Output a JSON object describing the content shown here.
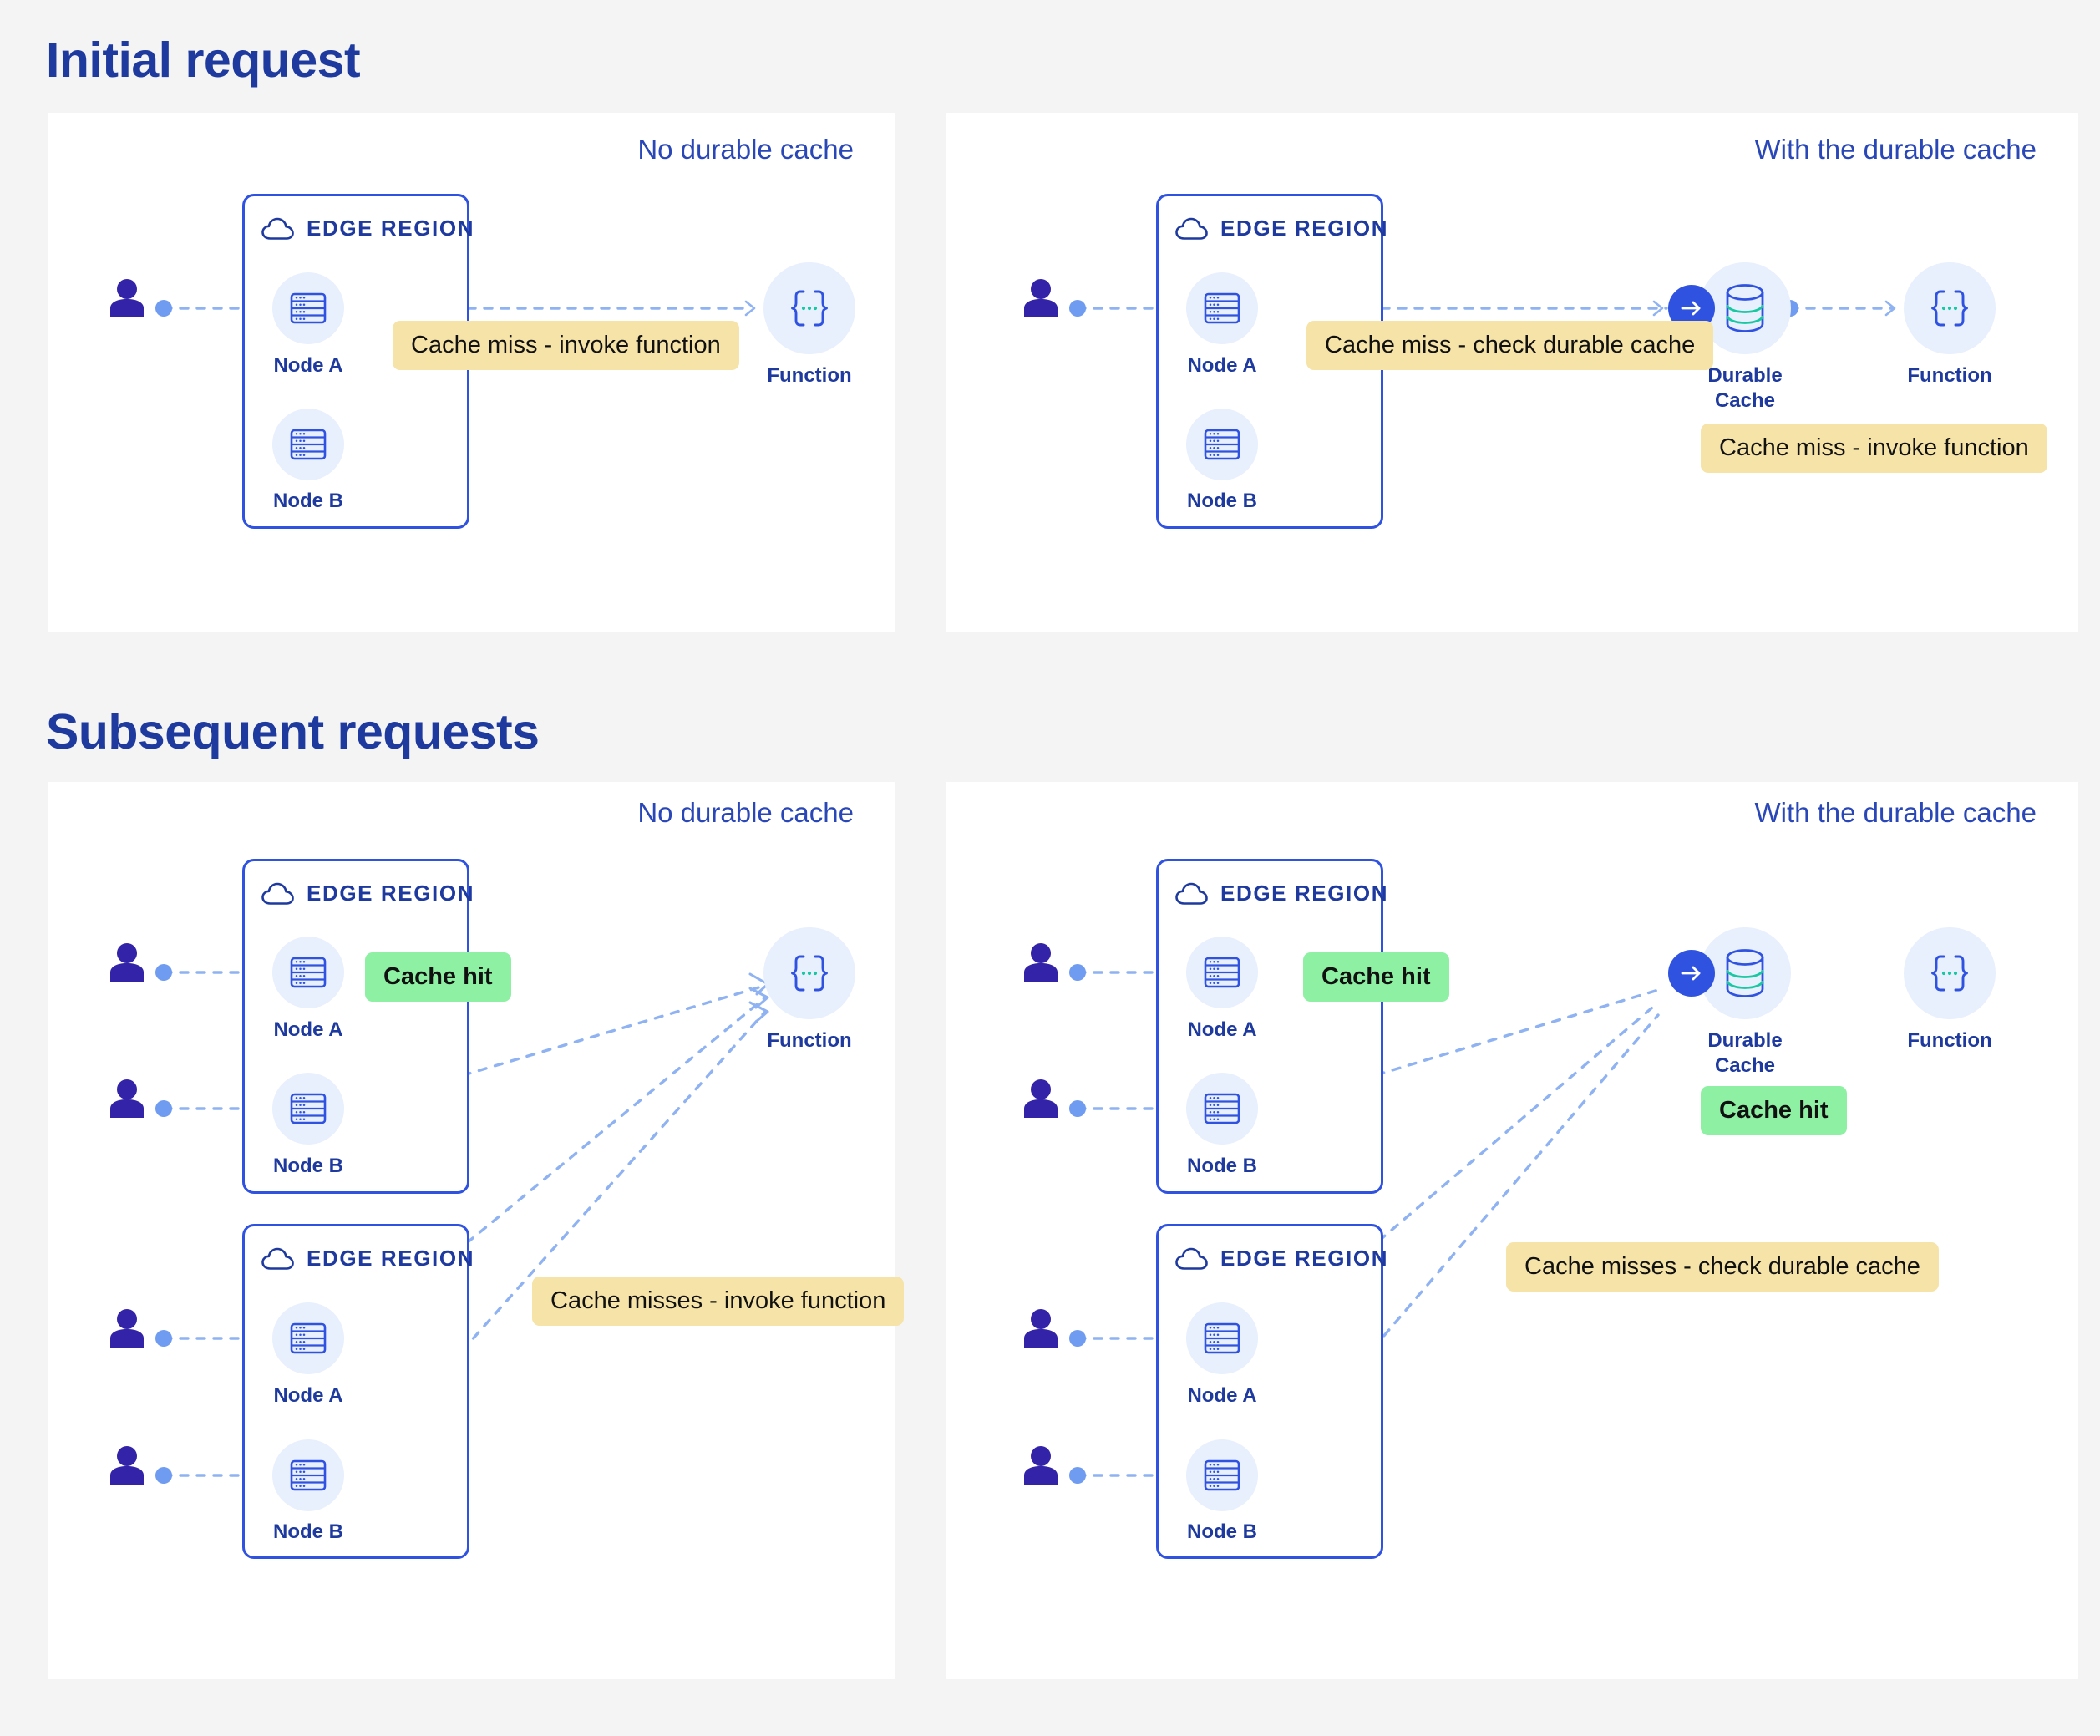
{
  "page": {
    "background": "#f4f4f5",
    "accent_blue": "#2f53e0",
    "title_blue": "#1e3a9e",
    "badge_yellow": "#f6e3a8",
    "badge_green": "#8ef0a3",
    "icon_teal": "#17c8a0"
  },
  "sections": [
    {
      "title": "Initial request"
    },
    {
      "title": "Subsequent requests"
    }
  ],
  "panels": {
    "top_left": {
      "caption": "No durable cache",
      "edge_region_label": "EDGE REGION",
      "nodes": [
        {
          "label": "Node A"
        },
        {
          "label": "Node B"
        }
      ],
      "function_label": "Function",
      "badges": [
        {
          "text": "Cache miss - invoke function",
          "kind": "yellow"
        }
      ]
    },
    "top_right": {
      "caption": "With the durable cache",
      "edge_region_label": "EDGE REGION",
      "nodes": [
        {
          "label": "Node A"
        },
        {
          "label": "Node B"
        }
      ],
      "durable_cache_label": "Durable\nCache",
      "durable_cache_line1": "Durable",
      "durable_cache_line2": "Cache",
      "function_label": "Function",
      "badges": [
        {
          "text": "Cache miss - check durable cache",
          "kind": "yellow"
        },
        {
          "text": "Cache miss - invoke function",
          "kind": "yellow"
        }
      ]
    },
    "bottom_left": {
      "caption": "No durable cache",
      "regions": [
        {
          "edge_region_label": "EDGE REGION",
          "nodes": [
            {
              "label": "Node A"
            },
            {
              "label": "Node B"
            }
          ]
        },
        {
          "edge_region_label": "EDGE REGION",
          "nodes": [
            {
              "label": "Node A"
            },
            {
              "label": "Node B"
            }
          ]
        }
      ],
      "function_label": "Function",
      "badges": [
        {
          "text": "Cache hit",
          "kind": "green"
        },
        {
          "text": "Cache misses - invoke function",
          "kind": "yellow"
        }
      ]
    },
    "bottom_right": {
      "caption": "With the durable cache",
      "regions": [
        {
          "edge_region_label": "EDGE REGION",
          "nodes": [
            {
              "label": "Node A"
            },
            {
              "label": "Node B"
            }
          ]
        },
        {
          "edge_region_label": "EDGE REGION",
          "nodes": [
            {
              "label": "Node A"
            },
            {
              "label": "Node B"
            }
          ]
        }
      ],
      "durable_cache_line1": "Durable",
      "durable_cache_line2": "Cache",
      "function_label": "Function",
      "badges": [
        {
          "text": "Cache hit",
          "kind": "green"
        },
        {
          "text": "Cache hit",
          "kind": "green"
        },
        {
          "text": "Cache misses - check durable cache",
          "kind": "yellow"
        }
      ]
    }
  },
  "icons": {
    "cloud": "cloud-icon",
    "server": "server-icon",
    "database": "database-icon",
    "braces": "braces-function-icon",
    "user": "user-icon",
    "arrow": "arrow-right-icon"
  }
}
